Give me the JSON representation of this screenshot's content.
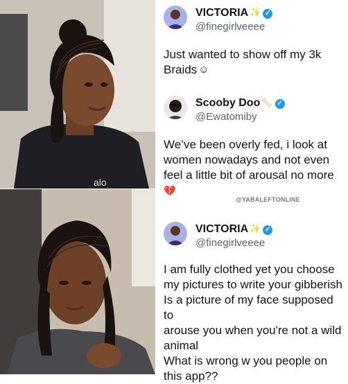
{
  "tweets": [
    {
      "name": "VICTORIA",
      "name_emoji": "sparkles-icon",
      "handle": "@finegirlveeee",
      "text": "Just wanted to show off my 3k Braids",
      "text_emoji": "blushing-face-icon"
    },
    {
      "name": "Scooby Doo",
      "name_emoji": "bone-icon",
      "handle": "@Ewatomiby",
      "lines": [
        "We’ve been overly fed, i look at",
        "women nowadays and not even",
        "feel a little bit of arousal no more"
      ],
      "text_emoji": "broken-heart-icon"
    },
    {
      "name": "VICTORIA",
      "name_emoji": "sparkles-icon",
      "handle": "@finegirlveeee",
      "lines": [
        "I am fully clothed yet you choose",
        "my pictures to write your gibberish",
        "Is a picture of my face supposed to",
        "arouse you when you're not a wild",
        "animal",
        "What is wrong w you people on",
        "this app??"
      ]
    }
  ],
  "watermark": "@YABALEFTONLINE",
  "photo_top_logo": "alo",
  "colors": {
    "verified": "#1d9bf0",
    "handle": "#536471",
    "text": "#0f1419"
  }
}
